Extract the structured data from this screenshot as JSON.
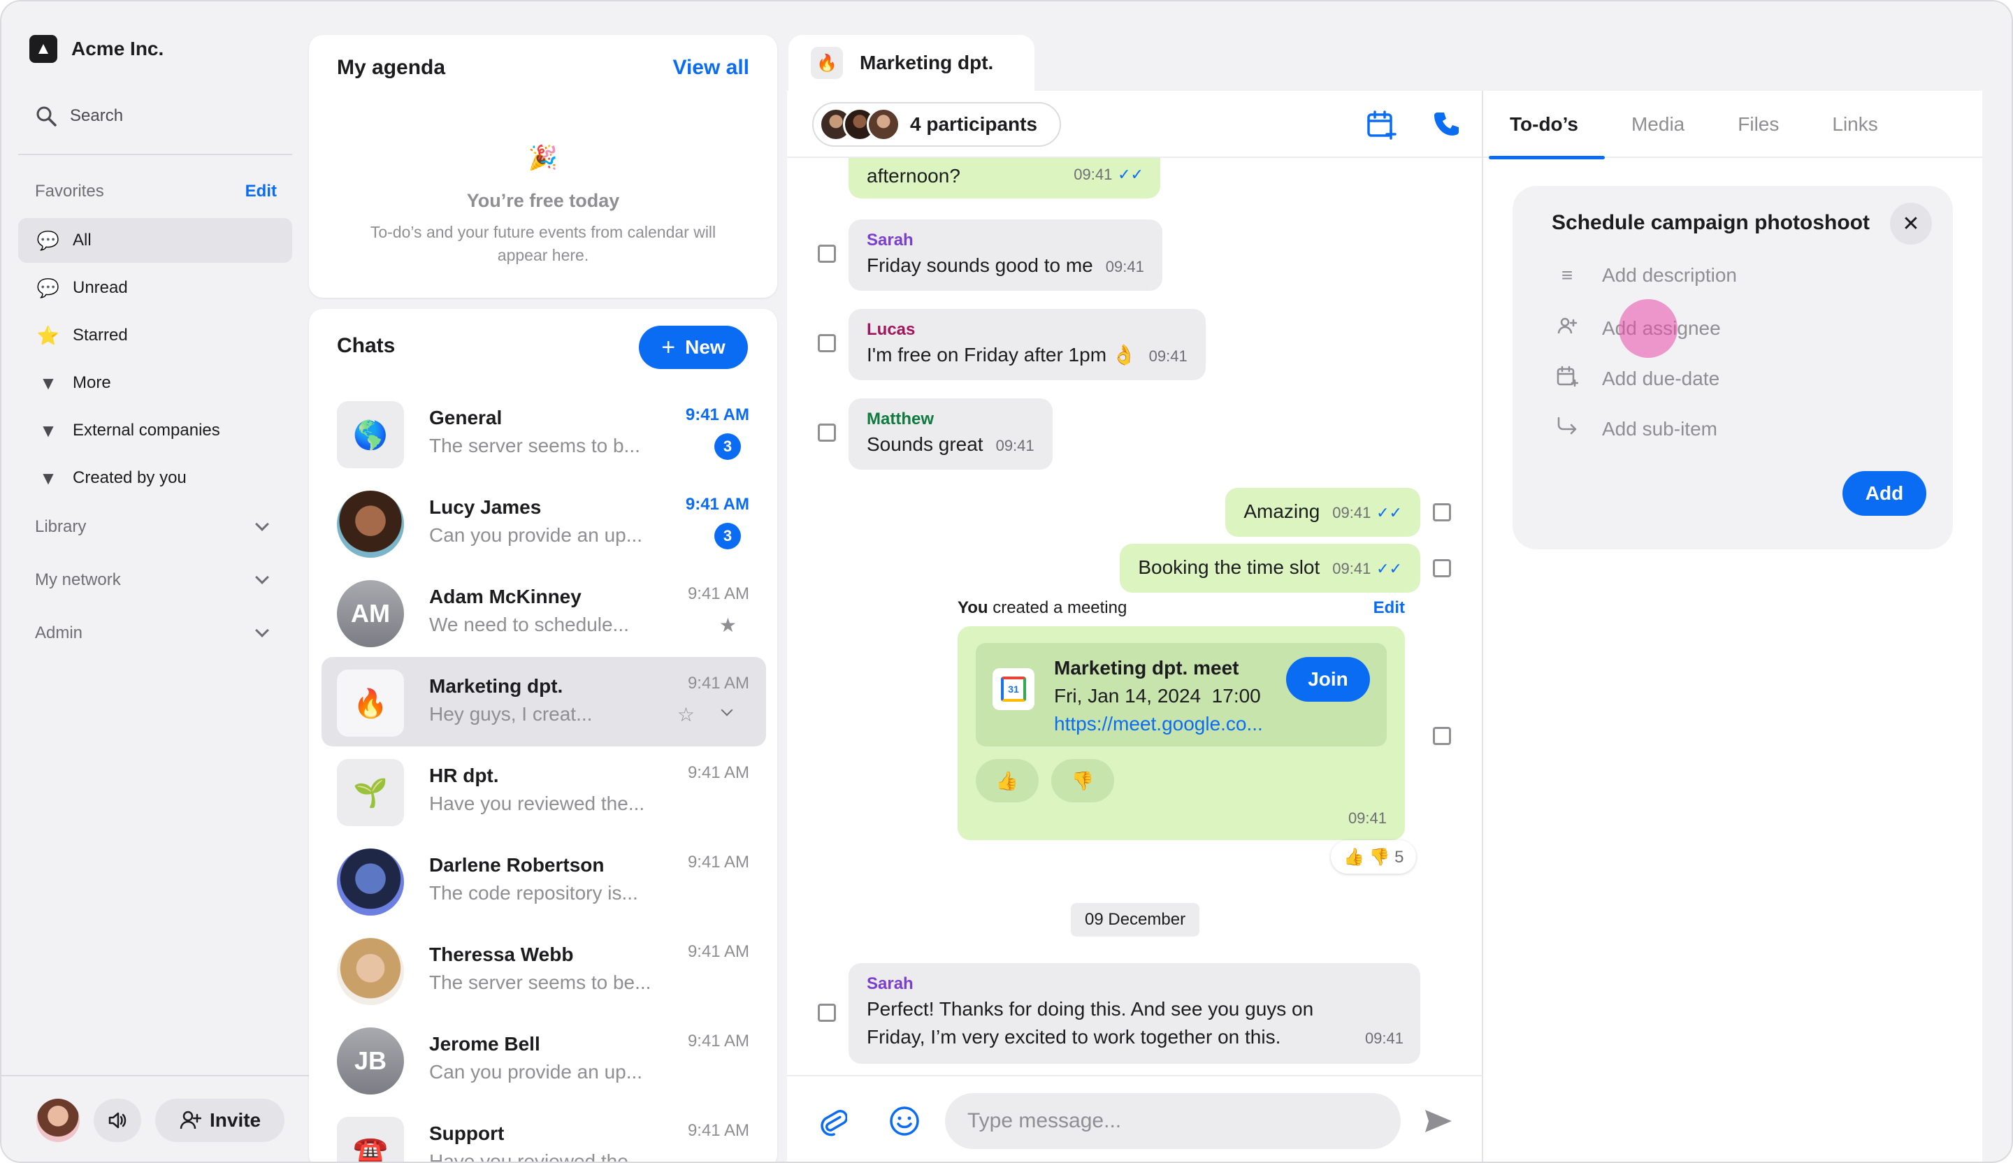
{
  "sidebar": {
    "brand": "Acme Inc.",
    "search_label": "Search",
    "favorites_label": "Favorites",
    "favorites_edit": "Edit",
    "items": [
      {
        "label": "All",
        "icon": "chat-bubble-icon"
      },
      {
        "label": "Unread",
        "icon": "unread-bubble-icon"
      },
      {
        "label": "Starred",
        "icon": "star-icon"
      },
      {
        "label": "More",
        "icon": "caret-down-icon"
      },
      {
        "label": "External companies",
        "icon": "caret-down-icon"
      },
      {
        "label": "Created by you",
        "icon": "caret-down-icon"
      }
    ],
    "sections": [
      "Library",
      "My network",
      "Admin"
    ],
    "invite_label": "Invite"
  },
  "agenda": {
    "title": "My agenda",
    "view_all": "View all",
    "free_title": "You’re free today",
    "free_desc": "To-do’s and your future events from calendar will appear here."
  },
  "chats": {
    "title": "Chats",
    "new_label": "New",
    "list": [
      {
        "name": "General",
        "preview": "The server seems to b...",
        "time": "9:41 AM",
        "badge": "3",
        "avatar": "🌎"
      },
      {
        "name": "Lucy James",
        "preview": "Can you provide an up...",
        "time": "9:41 AM",
        "badge": "3",
        "avatar": ""
      },
      {
        "name": "Adam McKinney",
        "preview": "We need to schedule...",
        "time": "9:41 AM",
        "avatar": "AM"
      },
      {
        "name": "Marketing dpt.",
        "preview": "Hey guys, I creat...",
        "time": "9:41 AM",
        "avatar": "🔥"
      },
      {
        "name": "HR dpt.",
        "preview": "Have you reviewed the...",
        "time": "9:41 AM",
        "avatar": "🌱"
      },
      {
        "name": "Darlene Robertson",
        "preview": "The code repository is...",
        "time": "9:41 AM",
        "avatar": ""
      },
      {
        "name": "Theressa Webb",
        "preview": "The server seems to be...",
        "time": "9:41 AM",
        "avatar": ""
      },
      {
        "name": "Jerome Bell",
        "preview": "Can you provide an up...",
        "time": "9:41 AM",
        "avatar": "JB"
      },
      {
        "name": "Support",
        "preview": "Have you reviewed the...",
        "time": "9:41 AM",
        "avatar": "☎️"
      }
    ]
  },
  "conversation": {
    "tab_title": "Marketing dpt.",
    "participants": "4 participants",
    "messages": {
      "m0_text": "afternoon?",
      "m0_time": "09:41",
      "m1_sender": "Sarah",
      "m1_text": "Friday sounds good to me",
      "m1_time": "09:41",
      "m2_sender": "Lucas",
      "m2_text": "I'm free on Friday after 1pm 👌",
      "m2_time": "09:41",
      "m3_sender": "Matthew",
      "m3_text": "Sounds great",
      "m3_time": "09:41",
      "m4_text": "Amazing",
      "m4_time": "09:41",
      "m5_text": "Booking the time slot",
      "m5_time": "09:41",
      "m7_sender": "Sarah",
      "m7_text1": "Perfect! Thanks for doing this. And see you guys on",
      "m7_text2": "Friday, I’m very excited to work together on this.",
      "m7_time": "09:41"
    },
    "meeting": {
      "you": "You",
      "created": "created a meeting",
      "edit": "Edit",
      "title": "Marketing dpt. meet",
      "datetime": "Fri, Jan 14, 2024  17:00",
      "link": "https://meet.google.co...",
      "join": "Join",
      "time": "09:41",
      "react_up": "👍",
      "react_down": "👎",
      "reactions": "👍 👎 5"
    },
    "date_divider": "09 December",
    "composer_placeholder": "Type message..."
  },
  "right_panel": {
    "tabs": [
      "To-do’s",
      "Media",
      "Files",
      "Links"
    ],
    "todo": {
      "title": "Schedule campaign photoshoot",
      "fields": [
        "Add description",
        "Add assignee",
        "Add due-date",
        "Add sub-item"
      ],
      "add_label": "Add"
    }
  },
  "colors": {
    "accent": "#0a6cf2",
    "outgoing_bubble": "#dbf4c0",
    "incoming_bubble": "#ececef",
    "cursor": "#e84baa"
  }
}
